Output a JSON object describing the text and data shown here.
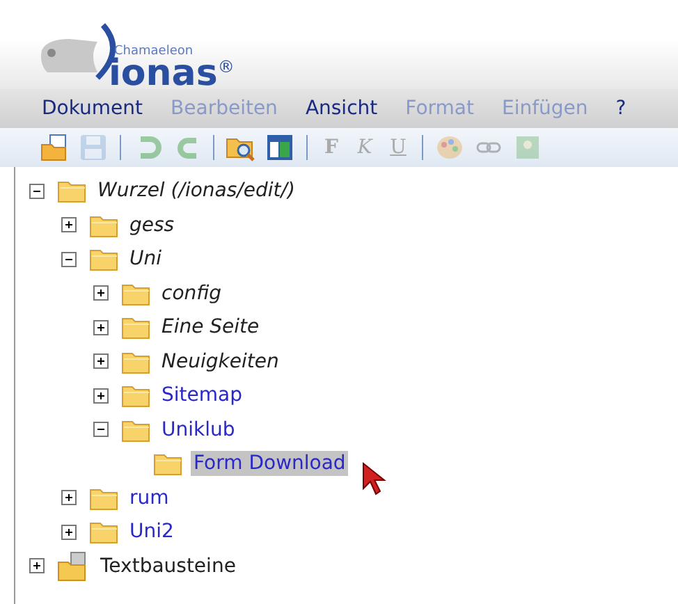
{
  "logo": {
    "tagline": "Chamaeleon",
    "name": "ionas",
    "mark": "®"
  },
  "menu": [
    {
      "label": "Dokument",
      "disabled": false
    },
    {
      "label": "Bearbeiten",
      "disabled": true
    },
    {
      "label": "Ansicht",
      "disabled": false
    },
    {
      "label": "Format",
      "disabled": true
    },
    {
      "label": "Einfügen",
      "disabled": true
    },
    {
      "label": "?",
      "disabled": false
    }
  ],
  "toolbar": [
    {
      "kind": "open",
      "disabled": false
    },
    {
      "kind": "save",
      "disabled": true
    },
    {
      "kind": "separator"
    },
    {
      "kind": "undo",
      "disabled": true
    },
    {
      "kind": "redo",
      "disabled": true
    },
    {
      "kind": "separator"
    },
    {
      "kind": "browse",
      "disabled": false
    },
    {
      "kind": "layout",
      "disabled": false
    },
    {
      "kind": "separator"
    },
    {
      "kind": "letter",
      "label": "F",
      "disabled": true
    },
    {
      "kind": "letter",
      "label": "K",
      "disabled": true
    },
    {
      "kind": "letter",
      "label": "U",
      "disabled": true
    },
    {
      "kind": "separator"
    },
    {
      "kind": "palette",
      "disabled": true
    },
    {
      "kind": "link",
      "disabled": true
    },
    {
      "kind": "image",
      "disabled": true
    }
  ],
  "tree": [
    {
      "label": "Wurzel (/ionas/edit/)",
      "kind": "folder",
      "expanded": true,
      "selected": false,
      "children": [
        {
          "label": "gess",
          "kind": "folder",
          "expanded": false,
          "selected": false
        },
        {
          "label": "Uni",
          "kind": "folder",
          "expanded": true,
          "selected": false,
          "children": [
            {
              "label": "config",
              "kind": "folder",
              "expanded": false,
              "selected": false
            },
            {
              "label": "Eine Seite",
              "kind": "folder",
              "expanded": false,
              "selected": false
            },
            {
              "label": "Neuigkeiten",
              "kind": "folder",
              "expanded": false,
              "selected": false
            },
            {
              "label": "Sitemap",
              "kind": "page",
              "expanded": false,
              "selected": false
            },
            {
              "label": "Uniklub",
              "kind": "page",
              "expanded": true,
              "selected": false,
              "children": [
                {
                  "label": "Form Download",
                  "kind": "page",
                  "selected": true
                }
              ]
            }
          ]
        },
        {
          "label": "rum",
          "kind": "page",
          "expanded": false,
          "selected": false
        },
        {
          "label": "Uni2",
          "kind": "page",
          "expanded": false,
          "selected": false
        }
      ]
    },
    {
      "label": "Textbausteine",
      "kind": "library",
      "expanded": false,
      "selected": false
    }
  ]
}
